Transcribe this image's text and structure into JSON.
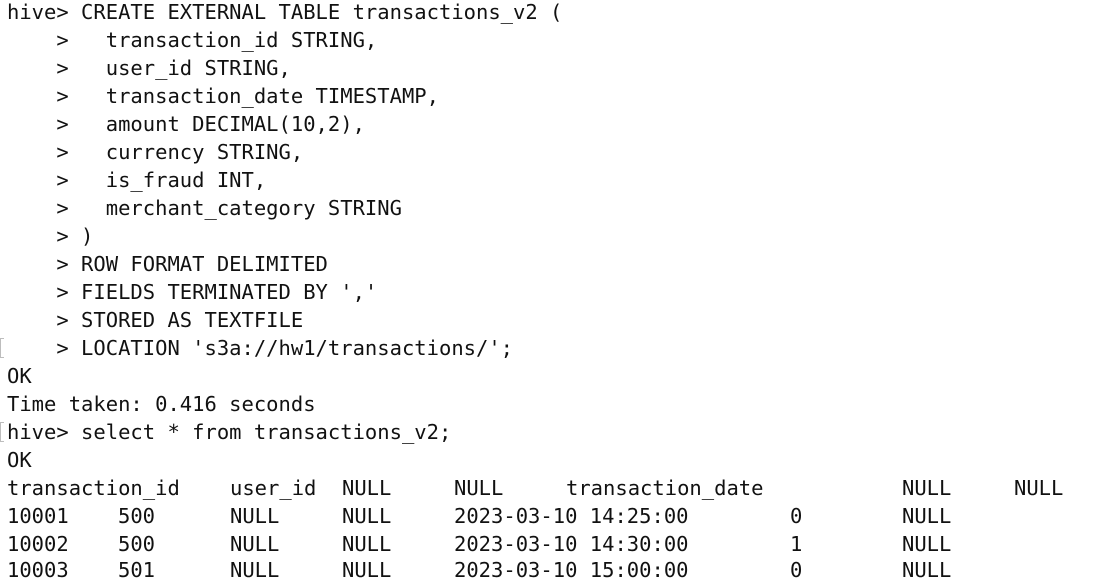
{
  "terminal": {
    "create_lines": [
      "hive> CREATE EXTERNAL TABLE transactions_v2 (",
      "    >   transaction_id STRING,",
      "    >   user_id STRING,",
      "    >   transaction_date TIMESTAMP,",
      "    >   amount DECIMAL(10,2),",
      "    >   currency STRING,",
      "    >   is_fraud INT,",
      "    >   merchant_category STRING",
      "    > )",
      "    > ROW FORMAT DELIMITED",
      "    > FIELDS TERMINATED BY ','",
      "    > STORED AS TEXTFILE",
      "    > LOCATION 's3a://hw1/transactions/';"
    ],
    "ok_1": "OK",
    "time_taken": "Time taken: 0.416 seconds",
    "select_command": "hive> select * from transactions_v2;",
    "ok_2": "OK",
    "result": {
      "header": [
        "transaction_id",
        "user_id",
        "NULL",
        "NULL",
        "transaction_date",
        "NULL",
        "NULL"
      ],
      "rows": [
        [
          "10001",
          "500",
          "NULL",
          "NULL",
          "2023-03-10 14:25:00",
          "0",
          "NULL"
        ],
        [
          "10002",
          "500",
          "NULL",
          "NULL",
          "2023-03-10 14:30:00",
          "1",
          "NULL"
        ],
        [
          "10003",
          "501",
          "NULL",
          "NULL",
          "2023-03-10 15:00:00",
          "0",
          "NULL"
        ]
      ]
    }
  }
}
